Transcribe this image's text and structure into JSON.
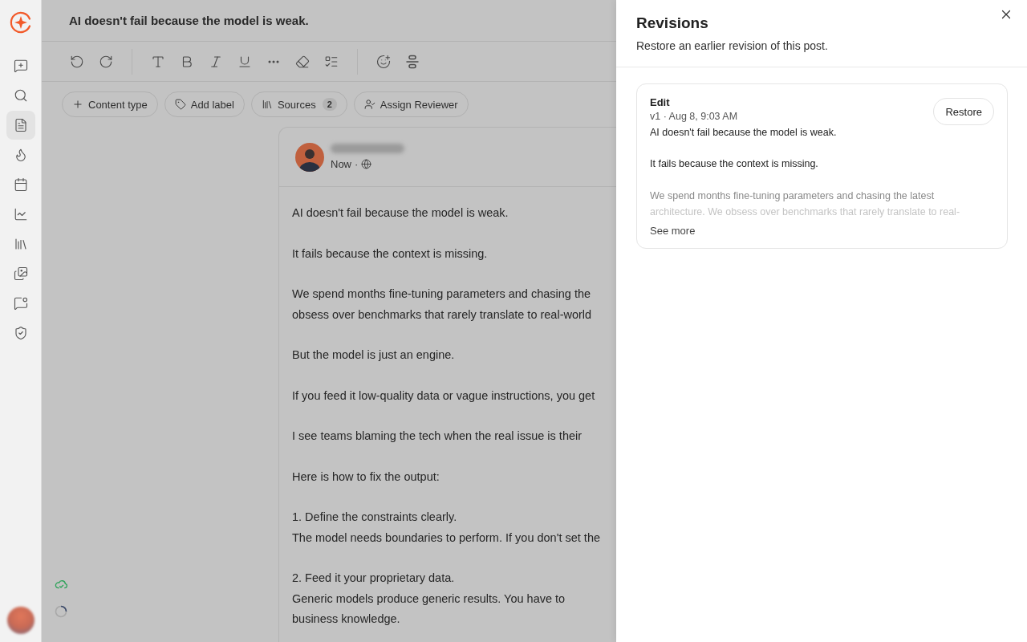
{
  "sidebar": {
    "items": [
      {
        "selected": false
      },
      {
        "selected": false
      },
      {
        "selected": true
      },
      {
        "selected": false
      },
      {
        "selected": false
      },
      {
        "selected": false
      },
      {
        "selected": false
      },
      {
        "selected": false
      },
      {
        "selected": false
      },
      {
        "selected": false
      }
    ]
  },
  "post_title": "AI doesn't fail because the model is weak.",
  "chips": [
    {
      "label": "Content type"
    },
    {
      "label": "Add label"
    },
    {
      "label": "Sources",
      "count": "2"
    },
    {
      "label": "Assign Reviewer"
    }
  ],
  "post": {
    "time": "Now",
    "separator": "·",
    "paragraphs": [
      [
        "AI doesn't fail because the model is weak."
      ],
      [
        "It fails because the context is missing."
      ],
      [
        "We spend months fine-tuning parameters and chasing the",
        "obsess over benchmarks that rarely translate to real-world"
      ],
      [
        "But the model is just an engine."
      ],
      [
        "If you feed it low-quality data or vague instructions, you get"
      ],
      [
        "I see teams blaming the tech when the real issue is their"
      ],
      [
        "Here is how to fix the output:"
      ],
      [
        "1. Define the constraints clearly.",
        "The model needs boundaries to perform. If you don't set the"
      ],
      [
        "2. Feed it your proprietary data.",
        "Generic models produce generic results. You have to",
        "business knowledge."
      ]
    ]
  },
  "drawer": {
    "title": "Revisions",
    "subtitle": "Restore an earlier revision of this post.",
    "revisions": [
      {
        "title": "Edit",
        "meta": "v1 · Aug 8, 9:03 AM",
        "action": "Restore",
        "preview": [
          "AI doesn't fail because the model is weak.",
          "It fails because the context is missing."
        ],
        "faded": [
          "We spend months fine-tuning parameters and chasing the latest",
          "architecture. We obsess over benchmarks that rarely translate to real-"
        ],
        "more": "See more"
      }
    ]
  }
}
